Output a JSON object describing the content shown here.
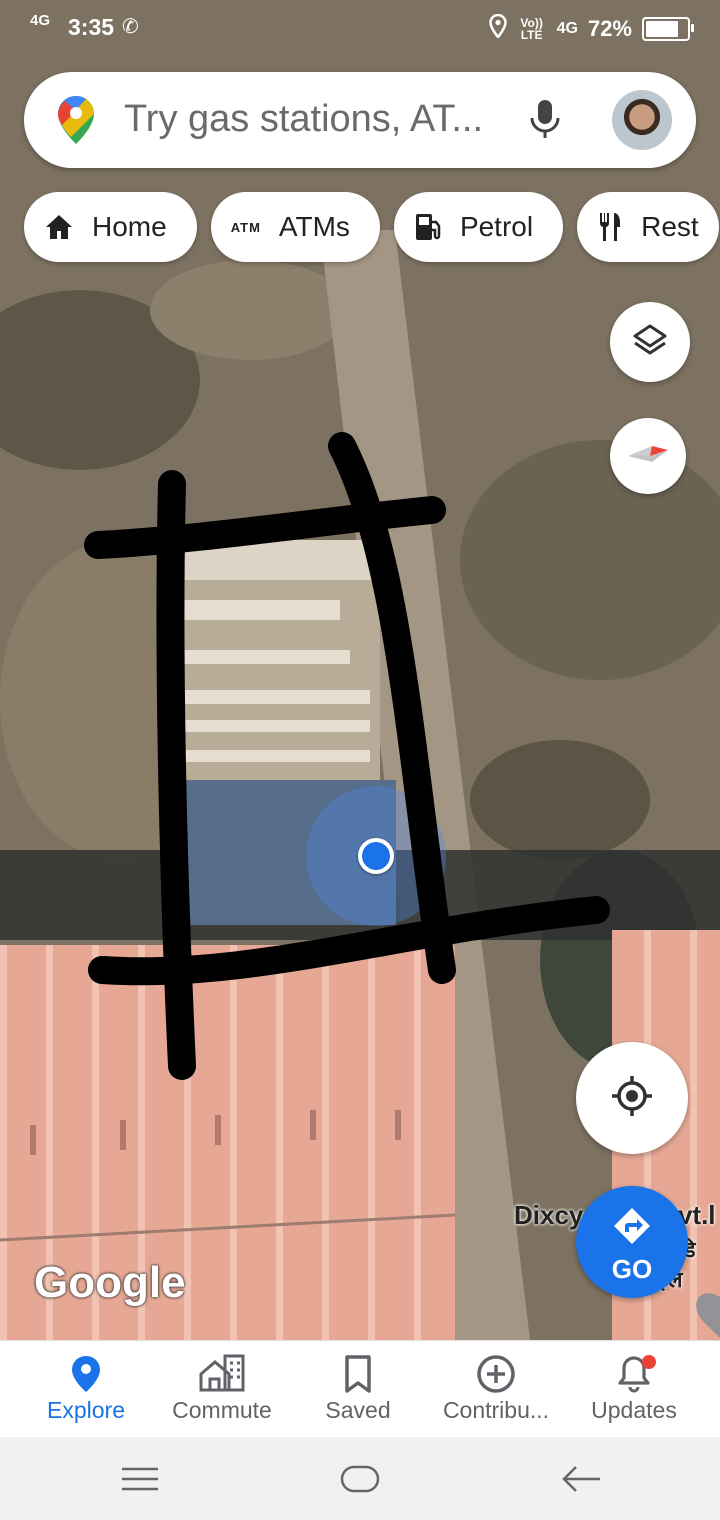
{
  "status_bar": {
    "network_left": "4G",
    "time": "3:35",
    "volte": "Vo)) LTE",
    "network_right": "4G",
    "battery": "72%",
    "battery_level": 0.72
  },
  "search": {
    "placeholder": "Try gas stations, AT..."
  },
  "chips": [
    {
      "label": "Home",
      "icon": "home-icon"
    },
    {
      "label": "ATMs",
      "icon": "atm-icon",
      "icon_text": "ATM"
    },
    {
      "label": "Petrol",
      "icon": "gas-pump-icon"
    },
    {
      "label": "Rest",
      "icon": "restaurant-icon"
    }
  ],
  "map": {
    "watermark": "Google",
    "business_label": "Dixcy",
    "business_label_tail": "Pvt.l",
    "business_label_local": "डि",
    "business_label_local2": "टाइल",
    "go_label": "GO"
  },
  "bottom_nav": [
    {
      "label": "Explore",
      "active": true
    },
    {
      "label": "Commute",
      "active": false
    },
    {
      "label": "Saved",
      "active": false
    },
    {
      "label": "Contribu...",
      "active": false
    },
    {
      "label": "Updates",
      "active": false
    }
  ],
  "colors": {
    "accent": "#1a73e8",
    "notification": "#ea4335"
  }
}
